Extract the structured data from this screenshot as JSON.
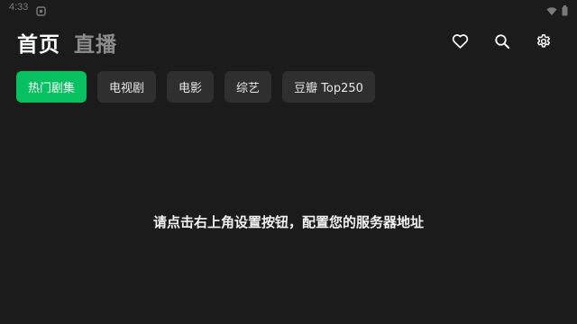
{
  "status_bar": {
    "time": "4:33",
    "notification_icon": "notification-icon",
    "wifi_icon": "wifi-icon",
    "battery_icon": "battery-icon"
  },
  "header": {
    "home_title": "首页",
    "live_title": "直播",
    "actions": {
      "favorite_icon": "heart-icon",
      "search_icon": "search-icon",
      "settings_icon": "gear-icon"
    }
  },
  "tabs": [
    {
      "label": "热门剧集",
      "active": true
    },
    {
      "label": "电视剧",
      "active": false
    },
    {
      "label": "电影",
      "active": false
    },
    {
      "label": "综艺",
      "active": false
    },
    {
      "label": "豆瓣 Top250",
      "active": false
    }
  ],
  "main": {
    "empty_message": "请点击右上角设置按钮，配置您的服务器地址"
  },
  "colors": {
    "background": "#1b1b1b",
    "accent": "#07c160",
    "tab_background": "#2f2f2f",
    "muted_title": "#8c8c8c"
  }
}
